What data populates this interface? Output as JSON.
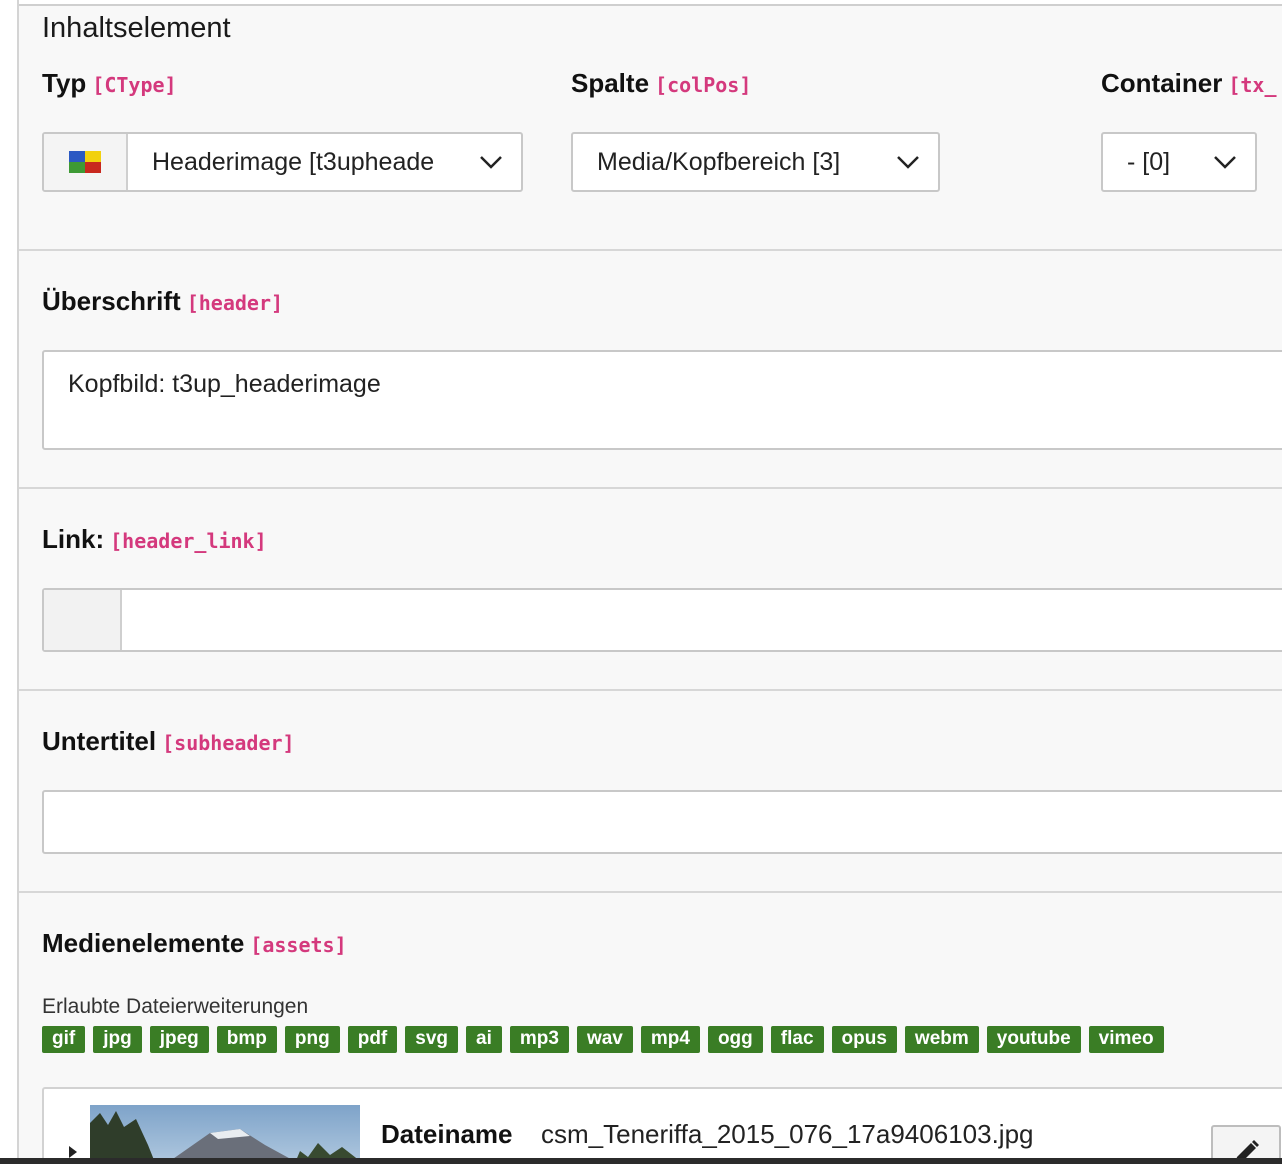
{
  "section_title": "Inhaltselement",
  "fields": {
    "typ": {
      "label": "Typ",
      "code": "[CType]",
      "value": "Headerimage [t3upheade",
      "icon": "content-type-icon"
    },
    "spalte": {
      "label": "Spalte",
      "code": "[colPos]",
      "value": "Media/Kopfbereich [3]"
    },
    "container": {
      "label": "Container",
      "code": "[tx_",
      "value": "- [0]"
    },
    "header": {
      "label": "Überschrift",
      "code": "[header]",
      "value": "Kopfbild: t3up_headerimage"
    },
    "header_link": {
      "label": "Link:",
      "code": "[header_link]",
      "value": ""
    },
    "subheader": {
      "label": "Untertitel",
      "code": "[subheader]",
      "value": ""
    },
    "assets": {
      "label": "Medienelemente",
      "code": "[assets]",
      "allowed_label": "Erlaubte Dateierweiterungen",
      "extensions": [
        "gif",
        "jpg",
        "jpeg",
        "bmp",
        "png",
        "pdf",
        "svg",
        "ai",
        "mp3",
        "wav",
        "mp4",
        "ogg",
        "flac",
        "opus",
        "webm",
        "youtube",
        "vimeo"
      ],
      "file": {
        "label": "Dateiname",
        "name": "csm_Teneriffa_2015_076_17a9406103.jpg",
        "icon": "pencil-icon"
      }
    }
  },
  "colors": {
    "code_color": "#d4397d",
    "tag_color": "#3a7d25"
  }
}
